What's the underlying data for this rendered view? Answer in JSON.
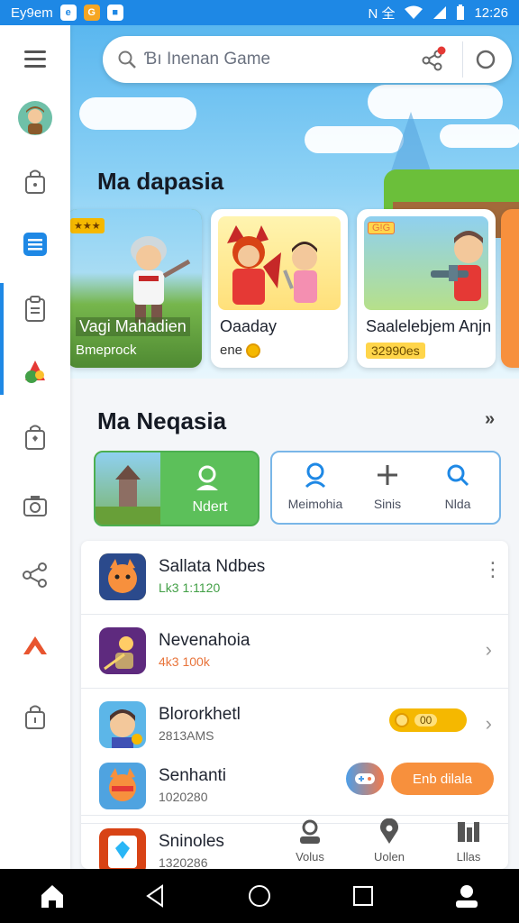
{
  "status_bar": {
    "carrier": "Ey9em",
    "signal_text": "N 全",
    "time": "12:26"
  },
  "search": {
    "placeholder": "Ɓı Inenan Game"
  },
  "hero": {
    "section_title": "Ma dapasia",
    "cards": [
      {
        "title": "Vagi Mahadien",
        "subtitle": "Bmeprock"
      },
      {
        "title": "Oaaday",
        "subtitle": "ene"
      },
      {
        "title": "Saalelebjem Anjn",
        "subtitle": "32990es"
      }
    ]
  },
  "middle": {
    "section_title": "Ma Neqasia",
    "more": "»",
    "featured_label": "Ndert",
    "quick_actions": [
      {
        "label": "Meimohia",
        "icon": "profile-icon"
      },
      {
        "label": "Sinis",
        "icon": "plus-icon"
      },
      {
        "label": "Nlda",
        "icon": "search-icon"
      }
    ]
  },
  "list": {
    "rows": [
      {
        "name": "Sallata Ndbes",
        "meta": "Lk3 1:1120",
        "meta_color": "#43a047"
      },
      {
        "name": "Nevenahoia",
        "meta": "4k3 100k",
        "meta_color": "#e8743b"
      },
      {
        "name": "Blororkhetl",
        "meta": "2813AMS",
        "meta_color": "#666666",
        "toggle_value": "00"
      },
      {
        "name": "Senhanti",
        "meta": "1020280",
        "meta_color": "#666666",
        "button_label": "Enb dilala"
      },
      {
        "name": "Sninoles",
        "meta": "1320286",
        "meta_color": "#666666"
      }
    ],
    "bottom_tabs": [
      {
        "label": "Volus",
        "icon": "user-icon"
      },
      {
        "label": "Uolen",
        "icon": "location-icon"
      },
      {
        "label": "Lllas",
        "icon": "chart-icon"
      }
    ]
  },
  "colors": {
    "accent": "#1e88e5",
    "green": "#5cc05a",
    "orange": "#f7903d"
  }
}
